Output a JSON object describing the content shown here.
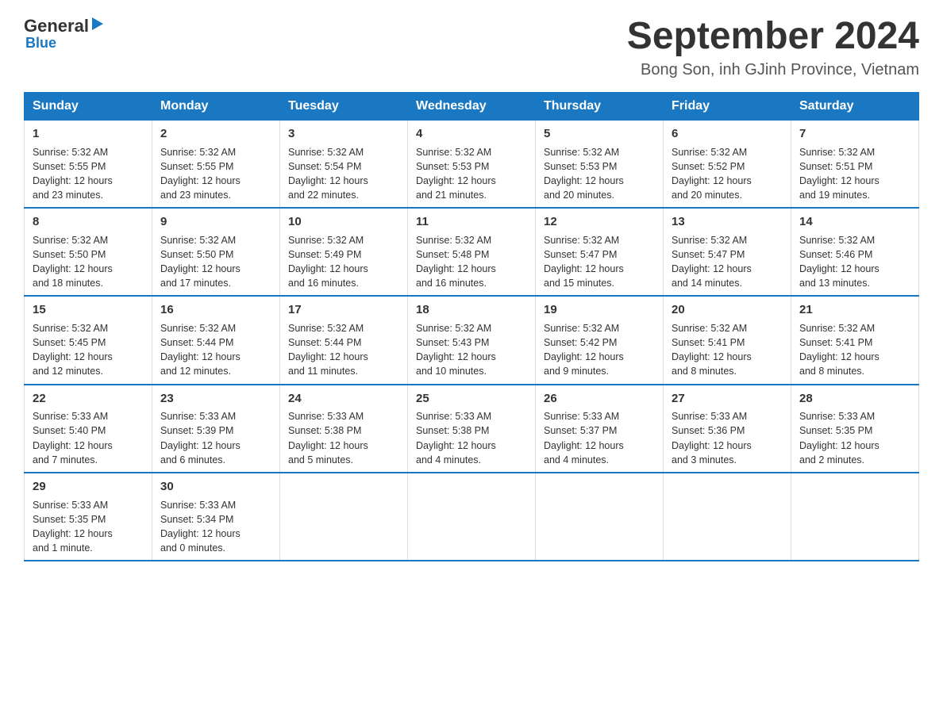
{
  "logo": {
    "general": "General",
    "blue": "Blue",
    "tagline": "Blue"
  },
  "title": "September 2024",
  "subtitle": "Bong Son, inh GJinh Province, Vietnam",
  "days_of_week": [
    "Sunday",
    "Monday",
    "Tuesday",
    "Wednesday",
    "Thursday",
    "Friday",
    "Saturday"
  ],
  "weeks": [
    [
      {
        "day": "1",
        "sunrise": "5:32 AM",
        "sunset": "5:55 PM",
        "daylight": "12 hours and 23 minutes."
      },
      {
        "day": "2",
        "sunrise": "5:32 AM",
        "sunset": "5:55 PM",
        "daylight": "12 hours and 23 minutes."
      },
      {
        "day": "3",
        "sunrise": "5:32 AM",
        "sunset": "5:54 PM",
        "daylight": "12 hours and 22 minutes."
      },
      {
        "day": "4",
        "sunrise": "5:32 AM",
        "sunset": "5:53 PM",
        "daylight": "12 hours and 21 minutes."
      },
      {
        "day": "5",
        "sunrise": "5:32 AM",
        "sunset": "5:53 PM",
        "daylight": "12 hours and 20 minutes."
      },
      {
        "day": "6",
        "sunrise": "5:32 AM",
        "sunset": "5:52 PM",
        "daylight": "12 hours and 20 minutes."
      },
      {
        "day": "7",
        "sunrise": "5:32 AM",
        "sunset": "5:51 PM",
        "daylight": "12 hours and 19 minutes."
      }
    ],
    [
      {
        "day": "8",
        "sunrise": "5:32 AM",
        "sunset": "5:50 PM",
        "daylight": "12 hours and 18 minutes."
      },
      {
        "day": "9",
        "sunrise": "5:32 AM",
        "sunset": "5:50 PM",
        "daylight": "12 hours and 17 minutes."
      },
      {
        "day": "10",
        "sunrise": "5:32 AM",
        "sunset": "5:49 PM",
        "daylight": "12 hours and 16 minutes."
      },
      {
        "day": "11",
        "sunrise": "5:32 AM",
        "sunset": "5:48 PM",
        "daylight": "12 hours and 16 minutes."
      },
      {
        "day": "12",
        "sunrise": "5:32 AM",
        "sunset": "5:47 PM",
        "daylight": "12 hours and 15 minutes."
      },
      {
        "day": "13",
        "sunrise": "5:32 AM",
        "sunset": "5:47 PM",
        "daylight": "12 hours and 14 minutes."
      },
      {
        "day": "14",
        "sunrise": "5:32 AM",
        "sunset": "5:46 PM",
        "daylight": "12 hours and 13 minutes."
      }
    ],
    [
      {
        "day": "15",
        "sunrise": "5:32 AM",
        "sunset": "5:45 PM",
        "daylight": "12 hours and 12 minutes."
      },
      {
        "day": "16",
        "sunrise": "5:32 AM",
        "sunset": "5:44 PM",
        "daylight": "12 hours and 12 minutes."
      },
      {
        "day": "17",
        "sunrise": "5:32 AM",
        "sunset": "5:44 PM",
        "daylight": "12 hours and 11 minutes."
      },
      {
        "day": "18",
        "sunrise": "5:32 AM",
        "sunset": "5:43 PM",
        "daylight": "12 hours and 10 minutes."
      },
      {
        "day": "19",
        "sunrise": "5:32 AM",
        "sunset": "5:42 PM",
        "daylight": "12 hours and 9 minutes."
      },
      {
        "day": "20",
        "sunrise": "5:32 AM",
        "sunset": "5:41 PM",
        "daylight": "12 hours and 8 minutes."
      },
      {
        "day": "21",
        "sunrise": "5:32 AM",
        "sunset": "5:41 PM",
        "daylight": "12 hours and 8 minutes."
      }
    ],
    [
      {
        "day": "22",
        "sunrise": "5:33 AM",
        "sunset": "5:40 PM",
        "daylight": "12 hours and 7 minutes."
      },
      {
        "day": "23",
        "sunrise": "5:33 AM",
        "sunset": "5:39 PM",
        "daylight": "12 hours and 6 minutes."
      },
      {
        "day": "24",
        "sunrise": "5:33 AM",
        "sunset": "5:38 PM",
        "daylight": "12 hours and 5 minutes."
      },
      {
        "day": "25",
        "sunrise": "5:33 AM",
        "sunset": "5:38 PM",
        "daylight": "12 hours and 4 minutes."
      },
      {
        "day": "26",
        "sunrise": "5:33 AM",
        "sunset": "5:37 PM",
        "daylight": "12 hours and 4 minutes."
      },
      {
        "day": "27",
        "sunrise": "5:33 AM",
        "sunset": "5:36 PM",
        "daylight": "12 hours and 3 minutes."
      },
      {
        "day": "28",
        "sunrise": "5:33 AM",
        "sunset": "5:35 PM",
        "daylight": "12 hours and 2 minutes."
      }
    ],
    [
      {
        "day": "29",
        "sunrise": "5:33 AM",
        "sunset": "5:35 PM",
        "daylight": "12 hours and 1 minute."
      },
      {
        "day": "30",
        "sunrise": "5:33 AM",
        "sunset": "5:34 PM",
        "daylight": "12 hours and 0 minutes."
      },
      null,
      null,
      null,
      null,
      null
    ]
  ],
  "labels": {
    "sunrise_prefix": "Sunrise: ",
    "sunset_prefix": "Sunset: ",
    "daylight_prefix": "Daylight: "
  }
}
